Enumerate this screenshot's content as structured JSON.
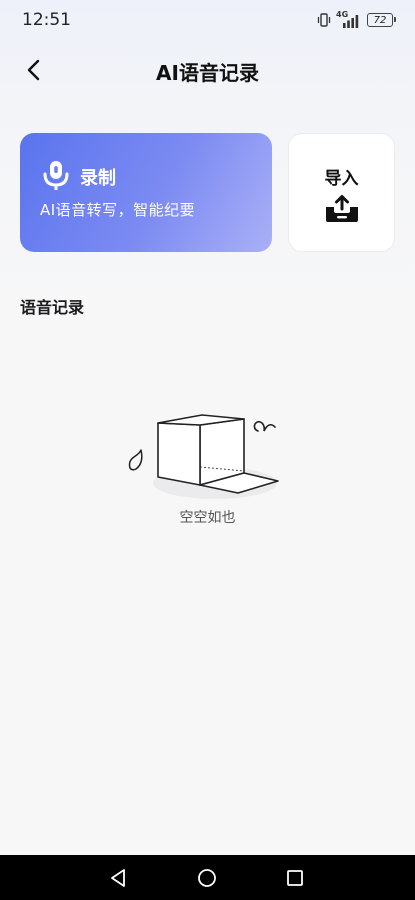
{
  "status_bar": {
    "time": "12:51",
    "network": "4G",
    "battery": "72",
    "icons": [
      "vibrate-icon",
      "signal-icon",
      "battery-icon"
    ]
  },
  "header": {
    "title": "AI语音记录",
    "back_icon": "chevron-left-icon"
  },
  "record_card": {
    "label": "录制",
    "subtitle": "AI语音转写，智能纪要",
    "icon": "microphone-icon",
    "colors": [
      "#5a74ee",
      "#aab0f7"
    ]
  },
  "import_card": {
    "label": "导入",
    "icon": "upload-tray-icon"
  },
  "section": {
    "title": "语音记录",
    "empty_text": "空空如也",
    "empty_icon": "empty-box-illustration"
  },
  "nav_bar": {
    "icons": [
      "triangle-back-icon",
      "circle-home-icon",
      "square-recents-icon"
    ]
  }
}
